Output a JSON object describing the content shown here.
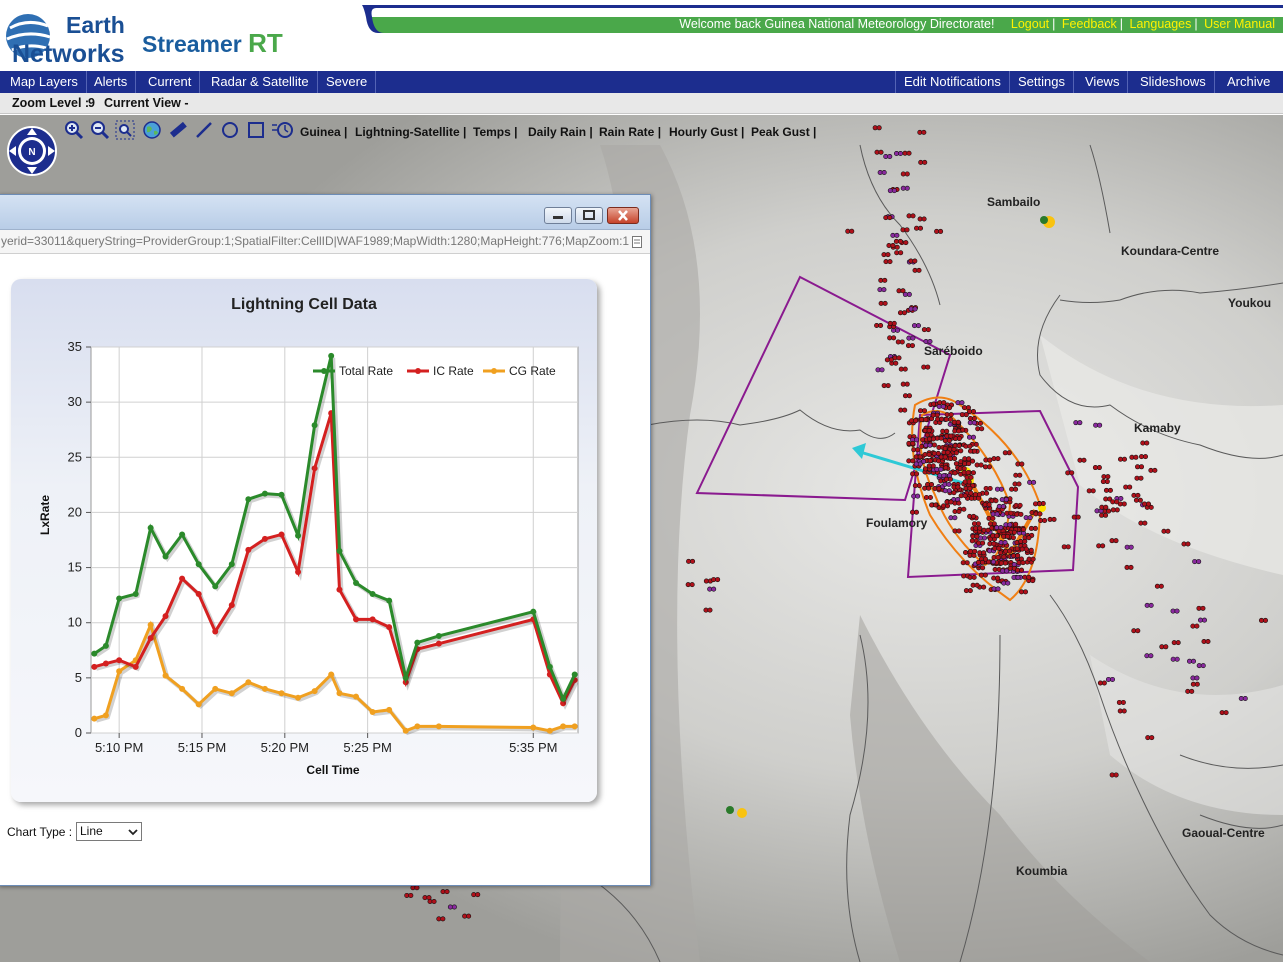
{
  "header": {
    "logo_line1": "Earth",
    "logo_line2": "Networks",
    "product": "Streamer",
    "product_suffix": "RT",
    "welcome": "Welcome back  Guinea National Meteorology Directorate!",
    "links": [
      "Logout",
      "Feedback",
      "Languages",
      "User Manual"
    ],
    "accent_green": "#4aa84a",
    "brand_blue": "#1c2d8e"
  },
  "nav": {
    "left": [
      "Map Layers",
      "Alerts",
      "Current",
      "Radar & Satellite",
      "Severe"
    ],
    "right": [
      "Edit Notifications",
      "Settings",
      "Views",
      "Slideshows",
      "Archive"
    ]
  },
  "status": {
    "zoom_label": "Zoom Level :",
    "zoom_value": "9",
    "view_label": "Current View -"
  },
  "toolbar": {
    "tools": [
      "zoom-in-icon",
      "zoom-out-icon",
      "zoom-box-icon",
      "globe-icon",
      "ruler-icon",
      "line-draw-icon",
      "circle-draw-icon",
      "rectangle-draw-icon",
      "animation-icon"
    ],
    "layers": [
      "Guinea",
      "Lightning-Satellite",
      "Temps",
      "Daily Rain",
      "Rain Rate",
      "Hourly Gust",
      "Peak Gust"
    ]
  },
  "map": {
    "cities": [
      "Sambailo",
      "Koundara-Centre",
      "Youkou",
      "Saréboido",
      "Kamaby",
      "Foulamory",
      "Gaoual-Centre",
      "Koumbia"
    ]
  },
  "popup": {
    "url": "yerid=33011&queryString=ProviderGroup:1;SpatialFilter:CellID|WAF1989;MapWidth:1280;MapHeight:776;MapZoom:1",
    "chart_type_label": "Chart Type :",
    "chart_type_value": "Line"
  },
  "chart_data": {
    "type": "line",
    "title": "Lightning Cell Data",
    "xlabel": "Cell Time",
    "ylabel": "LxRate",
    "ylim": [
      0,
      35
    ],
    "yticks": [
      0,
      5,
      10,
      15,
      20,
      25,
      30,
      35
    ],
    "xticks": [
      "5:10 PM",
      "5:15 PM",
      "5:20 PM",
      "5:25 PM",
      "5:35 PM"
    ],
    "xtick_minutes": [
      10,
      15,
      20,
      25,
      35
    ],
    "xlim_minutes": [
      8.3,
      37.7
    ],
    "x_minutes": [
      8.5,
      9.2,
      10.0,
      11.0,
      11.9,
      12.8,
      13.8,
      14.8,
      15.8,
      16.8,
      17.8,
      18.8,
      19.8,
      20.8,
      21.8,
      22.8,
      23.3,
      24.3,
      25.3,
      26.3,
      27.3,
      28.0,
      29.3,
      35.0,
      36.0,
      36.8,
      37.5
    ],
    "grid": true,
    "legend": "top-right",
    "series": [
      {
        "name": "Total Rate",
        "color": "#2b8a2b",
        "values": [
          7.2,
          7.9,
          12.2,
          12.6,
          18.6,
          16.0,
          18.0,
          15.3,
          13.3,
          15.3,
          21.2,
          21.7,
          21.6,
          17.9,
          27.9,
          34.2,
          16.5,
          13.6,
          12.6,
          12.0,
          5.0,
          8.2,
          8.8,
          11.0,
          6.0,
          3.1,
          5.3
        ]
      },
      {
        "name": "IC Rate",
        "color": "#d42020",
        "values": [
          6.0,
          6.3,
          6.6,
          6.0,
          8.6,
          10.6,
          14.0,
          12.6,
          9.2,
          11.6,
          16.6,
          17.6,
          18.0,
          14.6,
          24.0,
          29.0,
          13.0,
          10.3,
          10.3,
          9.6,
          4.6,
          7.6,
          8.1,
          10.3,
          5.3,
          2.7,
          4.8
        ]
      },
      {
        "name": "CG Rate",
        "color": "#f0a020",
        "values": [
          1.3,
          1.6,
          5.6,
          6.6,
          9.8,
          5.2,
          4.0,
          2.6,
          4.0,
          3.6,
          4.6,
          4.0,
          3.6,
          3.2,
          3.8,
          5.3,
          3.6,
          3.3,
          1.9,
          2.1,
          0.2,
          0.6,
          0.6,
          0.5,
          0.2,
          0.6,
          0.6
        ]
      }
    ]
  }
}
